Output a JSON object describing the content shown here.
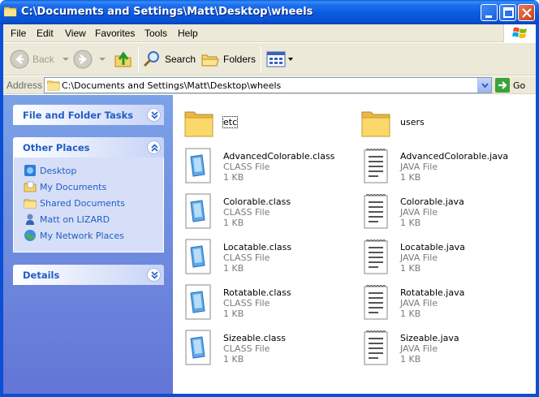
{
  "window": {
    "title": "C:\\Documents and Settings\\Matt\\Desktop\\wheels"
  },
  "menu": {
    "items": [
      "File",
      "Edit",
      "View",
      "Favorites",
      "Tools",
      "Help"
    ]
  },
  "toolbar": {
    "back_label": "Back",
    "search_label": "Search",
    "folders_label": "Folders"
  },
  "address": {
    "label": "Address",
    "value": "C:\\Documents and Settings\\Matt\\Desktop\\wheels",
    "go_label": "Go"
  },
  "taskpane": {
    "file_tasks_title": "File and Folder Tasks",
    "other_places_title": "Other Places",
    "other_places": [
      {
        "label": "Desktop",
        "icon": "desktop-icon"
      },
      {
        "label": "My Documents",
        "icon": "my-documents-icon"
      },
      {
        "label": "Shared Documents",
        "icon": "shared-documents-icon"
      },
      {
        "label": "Matt on LIZARD",
        "icon": "user-icon"
      },
      {
        "label": "My Network Places",
        "icon": "network-places-icon"
      }
    ],
    "details_title": "Details"
  },
  "files": [
    {
      "name": "etc",
      "kind": "folder"
    },
    {
      "name": "users",
      "kind": "folder"
    },
    {
      "name": "AdvancedColorable.class",
      "type": "CLASS File",
      "size": "1 KB",
      "kind": "class"
    },
    {
      "name": "AdvancedColorable.java",
      "type": "JAVA File",
      "size": "1 KB",
      "kind": "java"
    },
    {
      "name": "Colorable.class",
      "type": "CLASS File",
      "size": "1 KB",
      "kind": "class"
    },
    {
      "name": "Colorable.java",
      "type": "JAVA File",
      "size": "1 KB",
      "kind": "java"
    },
    {
      "name": "Locatable.class",
      "type": "CLASS File",
      "size": "1 KB",
      "kind": "class"
    },
    {
      "name": "Locatable.java",
      "type": "JAVA File",
      "size": "1 KB",
      "kind": "java"
    },
    {
      "name": "Rotatable.class",
      "type": "CLASS File",
      "size": "1 KB",
      "kind": "class"
    },
    {
      "name": "Rotatable.java",
      "type": "JAVA File",
      "size": "1 KB",
      "kind": "java"
    },
    {
      "name": "Sizeable.class",
      "type": "CLASS File",
      "size": "1 KB",
      "kind": "class"
    },
    {
      "name": "Sizeable.java",
      "type": "JAVA File",
      "size": "1 KB",
      "kind": "java"
    }
  ],
  "colors": {
    "titlebar": "#0a5ae0",
    "taskpane_link": "#215dc6",
    "menu_bg": "#ece9d8"
  }
}
